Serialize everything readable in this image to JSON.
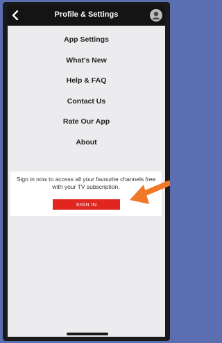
{
  "header": {
    "title": "Profile & Settings",
    "back_icon": "chevron-left-icon",
    "profile_icon": "avatar-icon"
  },
  "menu": {
    "items": [
      {
        "label": "App Settings"
      },
      {
        "label": "What's New"
      },
      {
        "label": "Help & FAQ"
      },
      {
        "label": "Contact Us"
      },
      {
        "label": "Rate Our App"
      },
      {
        "label": "About"
      }
    ]
  },
  "signin": {
    "message": "Sign in now to access all your favourite channels free with your TV subscription.",
    "button_label": "SIGN IN"
  },
  "annotation": {
    "icon": "arrow-icon"
  },
  "colors": {
    "background": "#5b6fb0",
    "topbar": "#141414",
    "accent_red": "#e0261f",
    "arrow_orange": "#f07826"
  }
}
